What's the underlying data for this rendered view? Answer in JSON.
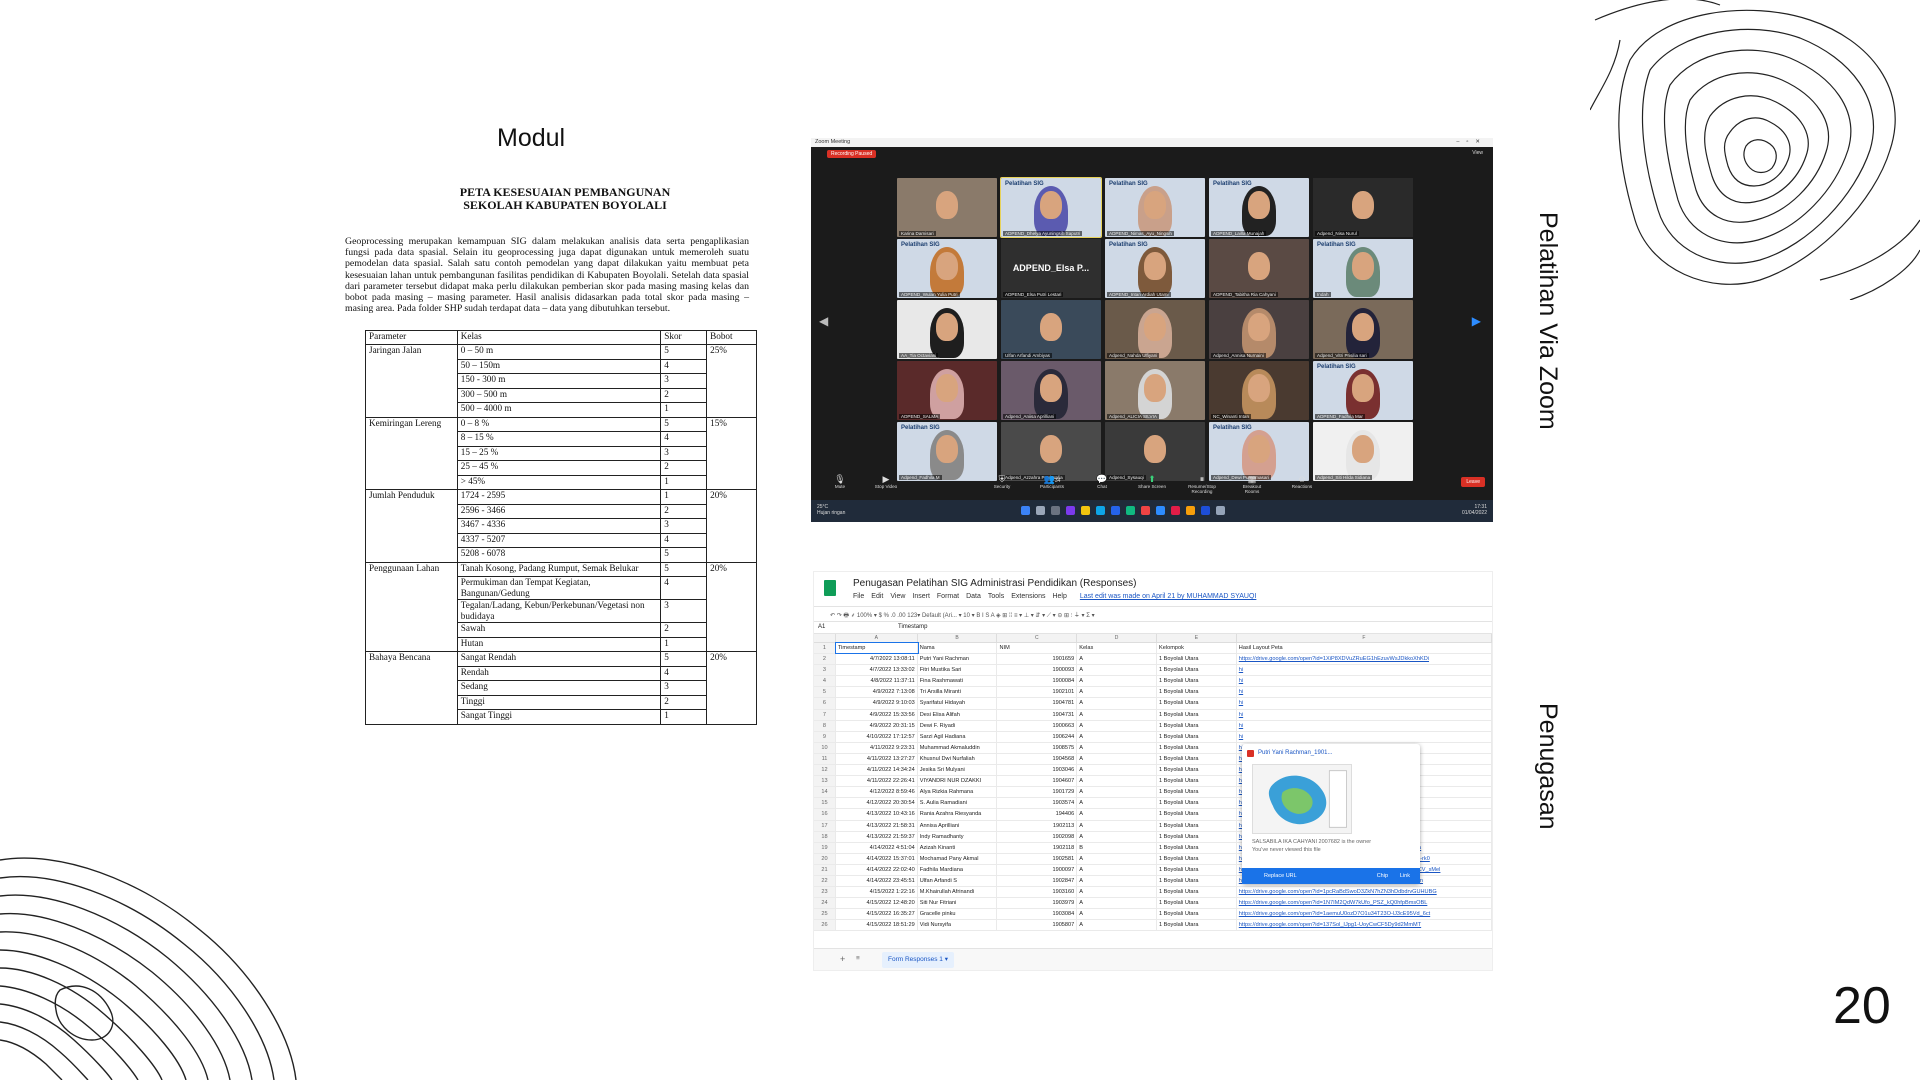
{
  "slide": {
    "page_number": "20"
  },
  "left": {
    "heading": "Modul",
    "doc_title_line1": "PETA KESESUAIAN PEMBANGUNAN",
    "doc_title_line2": "SEKOLAH KABUPATEN BOYOLALI",
    "paragraph": "Geoprocessing merupakan kemampuan SIG dalam melakukan analisis data serta pengaplikasian fungsi pada data spasial. Selain itu geoprocessing juga dapat digunakan untuk memeroleh suatu pemodelan data spasial. Salah satu contoh pemodelan yang dapat dilakukan yaitu membuat peta kesesuaian lahan untuk pembangunan fasilitas pendidikan di Kabupaten Boyolali. Setelah data spasial dari parameter tersebut didapat maka perlu dilakukan pemberian skor pada masing masing kelas dan bobot pada masing – masing parameter. Hasil analisis didasarkan pada total skor pada masing – masing area. Pada folder SHP sudah terdapat data – data yang dibutuhkan tersebut.",
    "table": {
      "headers": [
        "Parameter",
        "Kelas",
        "Skor",
        "Bobot"
      ],
      "groups": [
        {
          "parameter": "Jaringan Jalan",
          "bobot": "25%",
          "rows": [
            [
              "0 – 50 m",
              "5"
            ],
            [
              "50 – 150m",
              "4"
            ],
            [
              "150 - 300 m",
              "3"
            ],
            [
              "300 – 500 m",
              "2"
            ],
            [
              "500 – 4000 m",
              "1"
            ]
          ]
        },
        {
          "parameter": "Kemiringan Lereng",
          "bobot": "15%",
          "rows": [
            [
              "0 – 8 %",
              "5"
            ],
            [
              "8 – 15 %",
              "4"
            ],
            [
              "15 – 25 %",
              "3"
            ],
            [
              "25 – 45 %",
              "2"
            ],
            [
              "> 45%",
              "1"
            ]
          ]
        },
        {
          "parameter": "Jumlah Penduduk",
          "bobot": "20%",
          "rows": [
            [
              "1724 - 2595",
              "1"
            ],
            [
              "2596 - 3466",
              "2"
            ],
            [
              "3467 - 4336",
              "3"
            ],
            [
              "4337 - 5207",
              "4"
            ],
            [
              "5208 - 6078",
              "5"
            ]
          ]
        },
        {
          "parameter": "Penggunaan Lahan",
          "bobot": "20%",
          "rows": [
            [
              "Tanah Kosong, Padang Rumput, Semak Belukar",
              "5"
            ],
            [
              "Permukiman dan Tempat Kegiatan, Bangunan/Gedung",
              "4"
            ],
            [
              "Tegalan/Ladang, Kebun/Perkebunan/Vegetasi non budidaya",
              "3"
            ],
            [
              "Sawah",
              "2"
            ],
            [
              "Hutan",
              "1"
            ]
          ]
        },
        {
          "parameter": "Bahaya Bencana",
          "bobot": "20%",
          "rows": [
            [
              "Sangat Rendah",
              "5"
            ],
            [
              "Rendah",
              "4"
            ],
            [
              "Sedang",
              "3"
            ],
            [
              "Tinggi",
              "2"
            ],
            [
              "Sangat Tinggi",
              "1"
            ]
          ]
        }
      ]
    }
  },
  "labels": {
    "zoom": "Pelatihan Via Zoom",
    "assignment": "Penugasan"
  },
  "zoom": {
    "window_title": "Zoom Meeting",
    "recording": "Recording Paused",
    "view": "View",
    "participants": [
      {
        "name": "Karina Damisari",
        "bg": "#8a7a6a",
        "hijab": "",
        "poster": false
      },
      {
        "name": "ADPEND_Dhelya Ayuningsih Saputri",
        "bg": "#cfd9e6",
        "hijab": "#5b5bb0",
        "poster": true
      },
      {
        "name": "ADPEND_Nimas_Ayu_Ningsih",
        "bg": "#cfd9e6",
        "hijab": "#c9a08a",
        "poster": true
      },
      {
        "name": "ADPEND_Lailla Munajah",
        "bg": "#cfd9e6",
        "hijab": "#222222",
        "poster": true
      },
      {
        "name": "Adpend_Nisa Nurul",
        "bg": "#2a2a2a",
        "hijab": "",
        "poster": false
      },
      {
        "name": "ADPEND_Wulan Yulia Putri",
        "bg": "#cfd9e6",
        "hijab": "#c37a3a",
        "poster": true
      },
      {
        "name": "ADPEND_Elsa Putri Lestari",
        "bg": "#2f2f2f",
        "hijab": "",
        "poster": false,
        "big": "ADPEND_Elsa P..."
      },
      {
        "name": "ADPEND_Intan Ardiah Utami",
        "bg": "#cfd9e6",
        "hijab": "#7e5a3c",
        "poster": true
      },
      {
        "name": "ADPEND_Tabitha Ria Cahyani",
        "bg": "#5a4a44",
        "hijab": "",
        "poster": false
      },
      {
        "name": "Indah",
        "bg": "#cfd9e6",
        "hijab": "#6b8a7a",
        "poster": true
      },
      {
        "name": "AA_Tia Octaviani",
        "bg": "#e8e8e8",
        "hijab": "#1e1e1e",
        "poster": false
      },
      {
        "name": "Ulfan Arfandi Ambiyas",
        "bg": "#3a4a5a",
        "hijab": "",
        "poster": false
      },
      {
        "name": "Adpend_Nahda Ulfiyani",
        "bg": "#6a5a4a",
        "hijab": "#caa590",
        "poster": false
      },
      {
        "name": "Adpend_Annisa Nurnaini",
        "bg": "#4a4040",
        "hijab": "#b58a6a",
        "poster": false
      },
      {
        "name": "Adpend_Vitri Prisilia sari",
        "bg": "#7a6a5a",
        "hijab": "#23233a",
        "poster": false
      },
      {
        "name": "ADPEND_SALMA",
        "bg": "#5a2a2a",
        "hijab": "#cfa0a0",
        "poster": false
      },
      {
        "name": "Adpend_Aniisa Aprilliani",
        "bg": "#6a5a6a",
        "hijab": "#2a2a3a",
        "poster": false
      },
      {
        "name": "Adpend_ALICIA SILVIA",
        "bg": "#8a7a6a",
        "hijab": "#d4d4d4",
        "poster": false
      },
      {
        "name": "NC_Winanti Intan",
        "bg": "#4a3a30",
        "hijab": "#b88a5a",
        "poster": false
      },
      {
        "name": "ADPEND_Fadhila Mar",
        "bg": "#cfd9e6",
        "hijab": "#7a3030",
        "poster": true
      },
      {
        "name": "Adpend_Fadhila M",
        "bg": "#cfd9e6",
        "hijab": "#8a8a8a",
        "poster": true
      },
      {
        "name": "Adpend_Azzahra Putri Nalia",
        "bg": "#4a4a4a",
        "hijab": "",
        "poster": false
      },
      {
        "name": "Adpend_Sysauqi",
        "bg": "#3a3a3a",
        "hijab": "",
        "poster": false
      },
      {
        "name": "Adpend_Dewi Purnamasari",
        "bg": "#cfd9e6",
        "hijab": "#d4a090",
        "poster": true
      },
      {
        "name": "Adpend_Siti Hilda Sidiana",
        "bg": "#f0f0f0",
        "hijab": "#e6e6e6",
        "poster": false
      }
    ],
    "poster_tag": "Pelatihan SIG",
    "toolbar": [
      "Mute",
      "Stop Video",
      "Security",
      "Participants",
      "Chat",
      "Share Screen",
      "Resume/Stop Recording",
      "Breakout Rooms",
      "Reactions"
    ],
    "participants_count": "34",
    "leave": "Leave",
    "weather_temp": "25°C",
    "weather_desc": "Hujan ringan",
    "time": "17:31",
    "date": "01/04/2022",
    "page_left": "1/2",
    "page_right": "1/2"
  },
  "sheet": {
    "title": "Penugasan Pelatihan SIG Administrasi Pendidikan (Responses)",
    "menu": [
      "File",
      "Edit",
      "View",
      "Insert",
      "Format",
      "Data",
      "Tools",
      "Extensions",
      "Help"
    ],
    "last_edit": "Last edit was made on April 21 by MUHAMMAD SYAUQI",
    "toolbar": "↶ ↷ 🖶 ⸙  100% ▾  $  %  .0  .00  123▾  Default (Ari... ▾  10 ▾  B  I  S  A  ◈  ⊞  ⁞⁞  ≡ ▾  ⊥ ▾  ⇵ ▾  ⟋ ▾  ⊝  ⊞  ⫶  ⏚ ▾  Σ ▾",
    "cell_ref": "A1",
    "formula_value": "Timestamp",
    "col_letters": [
      "",
      "A",
      "B",
      "C",
      "D",
      "E",
      "F"
    ],
    "headers": [
      "Timestamp",
      "Nama",
      "NIM",
      "Kelas",
      "Kelompok",
      "Hasil Layout Peta"
    ],
    "rows": [
      [
        "4/7/2022 13:08:11",
        "Putri Yani Rachman",
        "1901659",
        "A",
        "1 Boyolali Utara",
        "https://drive.google.com/open?id=1XiP8XDVuZRuEG1hEzuvWsJDkkoXhKDi"
      ],
      [
        "4/7/2022 13:33:02",
        "Fitri Mustika Sari",
        "1900093",
        "A",
        "1 Boyolali Utara",
        "hi"
      ],
      [
        "4/8/2022 11:37:11",
        "Fina Rashmawati",
        "1900084",
        "A",
        "1 Boyolali Utara",
        "hi"
      ],
      [
        "4/9/2022 7:13:08",
        "Tri Arsilla Miranti",
        "1902101",
        "A",
        "1 Boyolali Utara",
        "hi"
      ],
      [
        "4/9/2022 9:10:03",
        "Syarifatul Hidayah",
        "1904781",
        "A",
        "1 Boyolali Utara",
        "hi"
      ],
      [
        "4/9/2022 15:33:56",
        "Desi Elisa Alifah",
        "1904731",
        "A",
        "1 Boyolali Utara",
        "hi"
      ],
      [
        "4/9/2022 20:31:15",
        "Dewi F. Riyadi",
        "1900663",
        "A",
        "1 Boyolali Utara",
        "hi"
      ],
      [
        "4/10/2022 17:12:57",
        "Sarzi Agil Hadiana",
        "1906244",
        "A",
        "1 Boyolali Utara",
        "hi"
      ],
      [
        "4/11/2022 9:23:31",
        "Muhammad Akmaluddin",
        "1908575",
        "A",
        "1 Boyolali Utara",
        "hi"
      ],
      [
        "4/11/2022 13:27:27",
        "Khusnul Dwi Nurfaliah",
        "1904568",
        "A",
        "1 Boyolali Utara",
        "hi"
      ],
      [
        "4/11/2022 14:34:24",
        "Jesika Sri Mulyani",
        "1903046",
        "A",
        "1 Boyolali Utara",
        "hi"
      ],
      [
        "4/11/2022 22:26:41",
        "VIYANDRI NUR DZAKKI",
        "1904607",
        "A",
        "1 Boyolali Utara",
        "hi"
      ],
      [
        "4/12/2022 8:59:46",
        "Alya Rizkia Rahmana",
        "1901729",
        "A",
        "1 Boyolali Utara",
        "hi"
      ],
      [
        "4/12/2022 20:30:54",
        "S. Aulia Ramadiani",
        "1903574",
        "A",
        "1 Boyolali Utara",
        "hi"
      ],
      [
        "4/13/2022 10:43:16",
        "Rania Azahra Riesyanda",
        "194406",
        "A",
        "1 Boyolali Utara",
        "https://drive.google.com/open?id=1ImxmVlgmQuVGo_HZo"
      ],
      [
        "4/13/2022 21:58:31",
        "Annisa Aprilliani",
        "1902113",
        "A",
        "1 Boyolali Utara",
        "https://drive.google.com/open?id=1INfJ7Jahdwov6tAh4RvWqUktNKLYR"
      ],
      [
        "4/13/2022 21:59:37",
        "Indy Ramadhanty",
        "1902098",
        "A",
        "1 Boyolali Utara",
        "https://drive.google.com/open?id=1JhHhKmwzdmf6jKYMsl1Ihrr2GzyjtM"
      ],
      [
        "4/14/2022 4:51:04",
        "Azizah Kinanti",
        "1902118",
        "B",
        "1 Boyolali Utara",
        "https://drive.google.com/open?id=1CbgVwnLRzhV21BN0in5BBK44zZbca"
      ],
      [
        "4/14/2022 15:37:01",
        "Mochamad Pany Akmal",
        "1902581",
        "A",
        "1 Boyolali Utara",
        "https://drive.google.com/open?id=1TkNpDrlEPhcRfJxvG9ZZnY7ZcxKlQA-rk0"
      ],
      [
        "4/14/2022 22:02:40",
        "Fadhila Mardiana",
        "1900097",
        "A",
        "1 Boyolali Utara",
        "https://drive.google.com/open?id=1f43uWbZma_wHvv-5CYTBRageEoQCV_sMel"
      ],
      [
        "4/14/2022 23:45:51",
        "Ulfan Arfandi S",
        "1902847",
        "A",
        "1 Boyolali Utara",
        "https://drive.google.com/open?id=1CAhrtaU5KHtP3DeR_80mVsPmHasbn"
      ],
      [
        "4/15/2022 1:22:16",
        "M.Khairullah Afrinandi",
        "1903160",
        "A",
        "1 Boyolali Utara",
        "https://drive.google.com/open?id=1pcRaBdSwoD3ZkN7hZN3hDdbdrvGUHUBG"
      ],
      [
        "4/15/2022 12:48:20",
        "Siti Nur Fitriani",
        "1903979",
        "A",
        "1 Boyolali Utara",
        "https://drive.google.com/open?id=1N7IM2QdW7kUfo_PSZ_kQ0hfpBmsOBL"
      ],
      [
        "4/15/2022 16:35:27",
        "Gracelle pinku",
        "1903084",
        "A",
        "1 Boyolali Utara",
        "https://drive.google.com/open?id=1aemuU0ozD7O1u34T23O-lJ3cE95Vd_6ct"
      ],
      [
        "4/15/2022 18:51:29",
        "Vidi Nursyifa",
        "1905807",
        "A",
        "1 Boyolali Utara",
        "https://drive.google.com/open?id=137Sol_IJpg1-UoyCwCF5Dy9d2MmMT"
      ]
    ],
    "popup": {
      "file_name": "Putri Yani Rachman_1901...",
      "owner": "SALSABILA IKA CAHYANI 2007682 is the owner",
      "viewed": "You've never viewed this file",
      "replace": "Replace URL",
      "chip": "Chip",
      "link": "Link"
    },
    "tab_name": "Form Responses 1 ▾"
  }
}
